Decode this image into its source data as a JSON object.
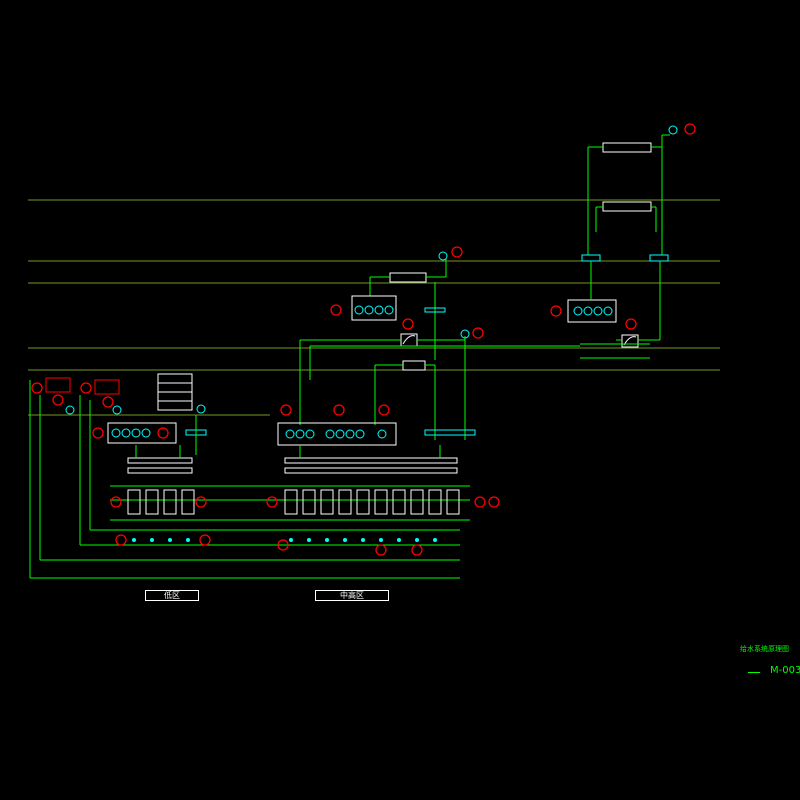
{
  "zones": {
    "low_zone_label": "低区",
    "mid_zone_label": "中高区"
  },
  "title_block": {
    "title": "给水系统原理图",
    "drawing_number": "M-003"
  },
  "colors": {
    "background": "#000000",
    "floor_lines": "#9acd32",
    "pipes": "#00ff00",
    "equipment": "#ffffff",
    "pumps": "#00ffff",
    "valves_flagged": "#ff0000",
    "text": "#00ff00"
  },
  "icons": [
    "pump-icon",
    "valve-icon",
    "gauge-icon",
    "tank-icon",
    "heat-exchanger-icon"
  ]
}
